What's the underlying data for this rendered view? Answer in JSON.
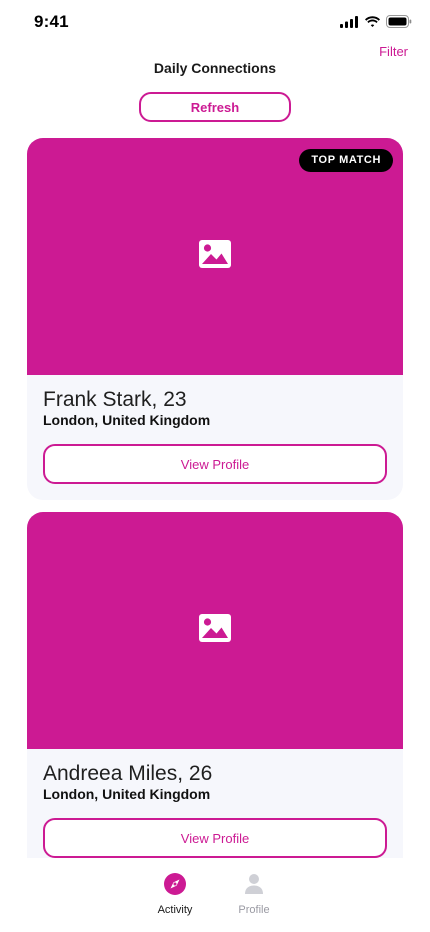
{
  "status_bar": {
    "time": "9:41"
  },
  "header": {
    "title": "Daily Connections",
    "filter_label": "Filter",
    "refresh_label": "Refresh"
  },
  "cards": [
    {
      "name": "Frank Stark, 23",
      "location": "London, United Kingdom",
      "badge": "TOP MATCH",
      "button_label": "View Profile"
    },
    {
      "name": "Andreea Miles, 26",
      "location": "London, United Kingdom",
      "badge": "",
      "button_label": "View Profile"
    }
  ],
  "tabs": [
    {
      "label": "Activity",
      "icon": "compass-icon",
      "active": true
    },
    {
      "label": "Profile",
      "icon": "person-icon",
      "active": false
    }
  ],
  "colors": {
    "accent": "#cc1a93",
    "card_bg": "#f6f7fc",
    "badge_bg": "#000000"
  }
}
